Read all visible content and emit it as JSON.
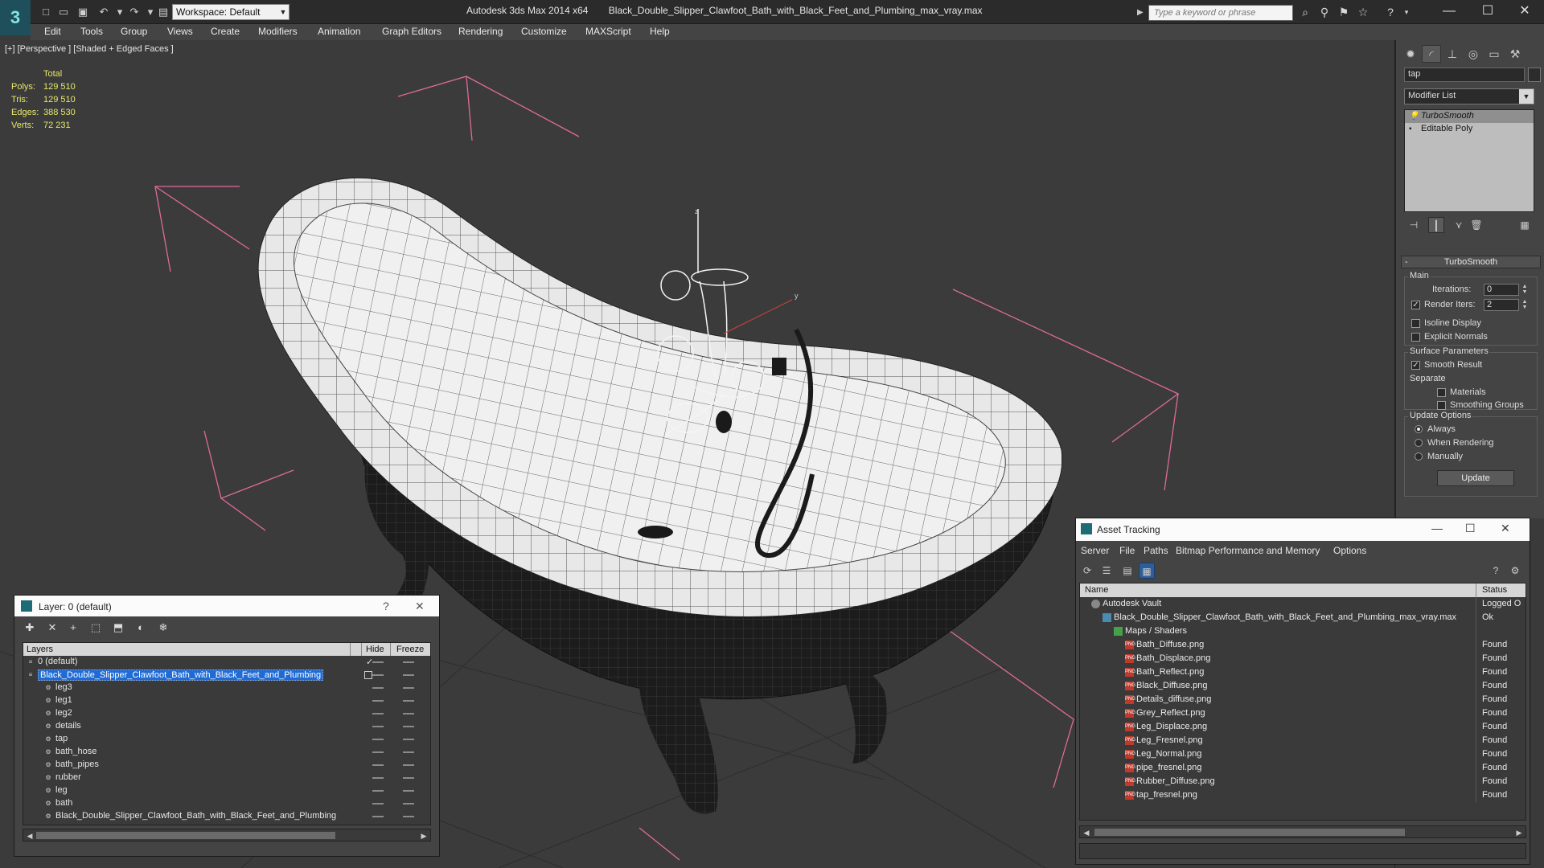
{
  "titlebar": {
    "app_name": "Autodesk 3ds Max  2014 x64",
    "file_name": "Black_Double_Slipper_Clawfoot_Bath_with_Black_Feet_and_Plumbing_max_vray.max",
    "workspace": "Workspace: Default",
    "search_placeholder": "Type a keyword or phrase",
    "logo": "3"
  },
  "menu": [
    "Edit",
    "Tools",
    "Group",
    "Views",
    "Create",
    "Modifiers",
    "Animation",
    "Graph Editors",
    "Rendering",
    "Customize",
    "MAXScript",
    "Help"
  ],
  "viewport": {
    "label": "[+] [Perspective ] [Shaded + Edged Faces ]",
    "stats": {
      "header": "Total",
      "rows": [
        {
          "k": "Polys:",
          "v": "129 510"
        },
        {
          "k": "Tris:",
          "v": "129 510"
        },
        {
          "k": "Edges:",
          "v": "388 530"
        },
        {
          "k": "Verts:",
          "v": "72 231"
        }
      ]
    },
    "axis_z": "z",
    "axis_y": "y"
  },
  "command_panel": {
    "object_name": "tap",
    "modifier_list": "Modifier List",
    "stack": [
      "TurboSmooth",
      "Editable Poly"
    ],
    "rollout_title": "TurboSmooth",
    "main_group": "Main",
    "iterations_label": "Iterations:",
    "iterations_value": "0",
    "render_iters_label": "Render Iters:",
    "render_iters_value": "2",
    "isoline": "Isoline Display",
    "explicit_normals": "Explicit Normals",
    "surface_group": "Surface Parameters",
    "smooth_result": "Smooth Result",
    "separate": "Separate",
    "materials": "Materials",
    "smoothing_groups": "Smoothing Groups",
    "update_group": "Update Options",
    "always": "Always",
    "when_rendering": "When Rendering",
    "manually": "Manually",
    "update_button": "Update"
  },
  "asset_tracking": {
    "title": "Asset Tracking",
    "menu": [
      "Server",
      "File",
      "Paths",
      "Bitmap Performance and Memory",
      "Options"
    ],
    "col_name": "Name",
    "col_status": "Status",
    "rows": [
      {
        "name": "Autodesk Vault",
        "status": "Logged O",
        "indent": 14,
        "icon": "vault"
      },
      {
        "name": "Black_Double_Slipper_Clawfoot_Bath_with_Black_Feet_and_Plumbing_max_vray.max",
        "status": "Ok",
        "indent": 28,
        "icon": "max"
      },
      {
        "name": "Maps / Shaders",
        "status": "",
        "indent": 42,
        "icon": "folder"
      },
      {
        "name": "Bath_Diffuse.png",
        "status": "Found",
        "indent": 56,
        "icon": "png"
      },
      {
        "name": "Bath_Displace.png",
        "status": "Found",
        "indent": 56,
        "icon": "png"
      },
      {
        "name": "Bath_Reflect.png",
        "status": "Found",
        "indent": 56,
        "icon": "png"
      },
      {
        "name": "Black_Diffuse.png",
        "status": "Found",
        "indent": 56,
        "icon": "png"
      },
      {
        "name": "Details_diffuse.png",
        "status": "Found",
        "indent": 56,
        "icon": "png"
      },
      {
        "name": "Grey_Reflect.png",
        "status": "Found",
        "indent": 56,
        "icon": "png"
      },
      {
        "name": "Leg_Displace.png",
        "status": "Found",
        "indent": 56,
        "icon": "png"
      },
      {
        "name": "Leg_Fresnel.png",
        "status": "Found",
        "indent": 56,
        "icon": "png"
      },
      {
        "name": "Leg_Normal.png",
        "status": "Found",
        "indent": 56,
        "icon": "png"
      },
      {
        "name": "pipe_fresnel.png",
        "status": "Found",
        "indent": 56,
        "icon": "png"
      },
      {
        "name": "Rubber_Diffuse.png",
        "status": "Found",
        "indent": 56,
        "icon": "png"
      },
      {
        "name": "tap_fresnel.png",
        "status": "Found",
        "indent": 56,
        "icon": "png"
      }
    ]
  },
  "layer_window": {
    "title": "Layer: 0 (default)",
    "help": "?",
    "col_layers": "Layers",
    "col_hide": "Hide",
    "col_freeze": "Freeze",
    "rows": [
      {
        "name": "0 (default)",
        "indent": 18,
        "type": "layer",
        "sel": false,
        "check": true
      },
      {
        "name": "Black_Double_Slipper_Clawfoot_Bath_with_Black_Feet_and_Plumbing",
        "indent": 18,
        "type": "layer",
        "sel": true,
        "check": false
      },
      {
        "name": "leg3",
        "indent": 40,
        "type": "object"
      },
      {
        "name": "leg1",
        "indent": 40,
        "type": "object"
      },
      {
        "name": "leg2",
        "indent": 40,
        "type": "object"
      },
      {
        "name": "details",
        "indent": 40,
        "type": "object"
      },
      {
        "name": "tap",
        "indent": 40,
        "type": "object"
      },
      {
        "name": "bath_hose",
        "indent": 40,
        "type": "object"
      },
      {
        "name": "bath_pipes",
        "indent": 40,
        "type": "object"
      },
      {
        "name": "rubber",
        "indent": 40,
        "type": "object"
      },
      {
        "name": "leg",
        "indent": 40,
        "type": "object"
      },
      {
        "name": "bath",
        "indent": 40,
        "type": "object"
      },
      {
        "name": "Black_Double_Slipper_Clawfoot_Bath_with_Black_Feet_and_Plumbing",
        "indent": 40,
        "type": "object"
      }
    ]
  },
  "colors": {
    "stats_yellow": "#e8e86a",
    "selection_blue": "#1e6bd6",
    "bbox_pink": "#e06a9a"
  }
}
